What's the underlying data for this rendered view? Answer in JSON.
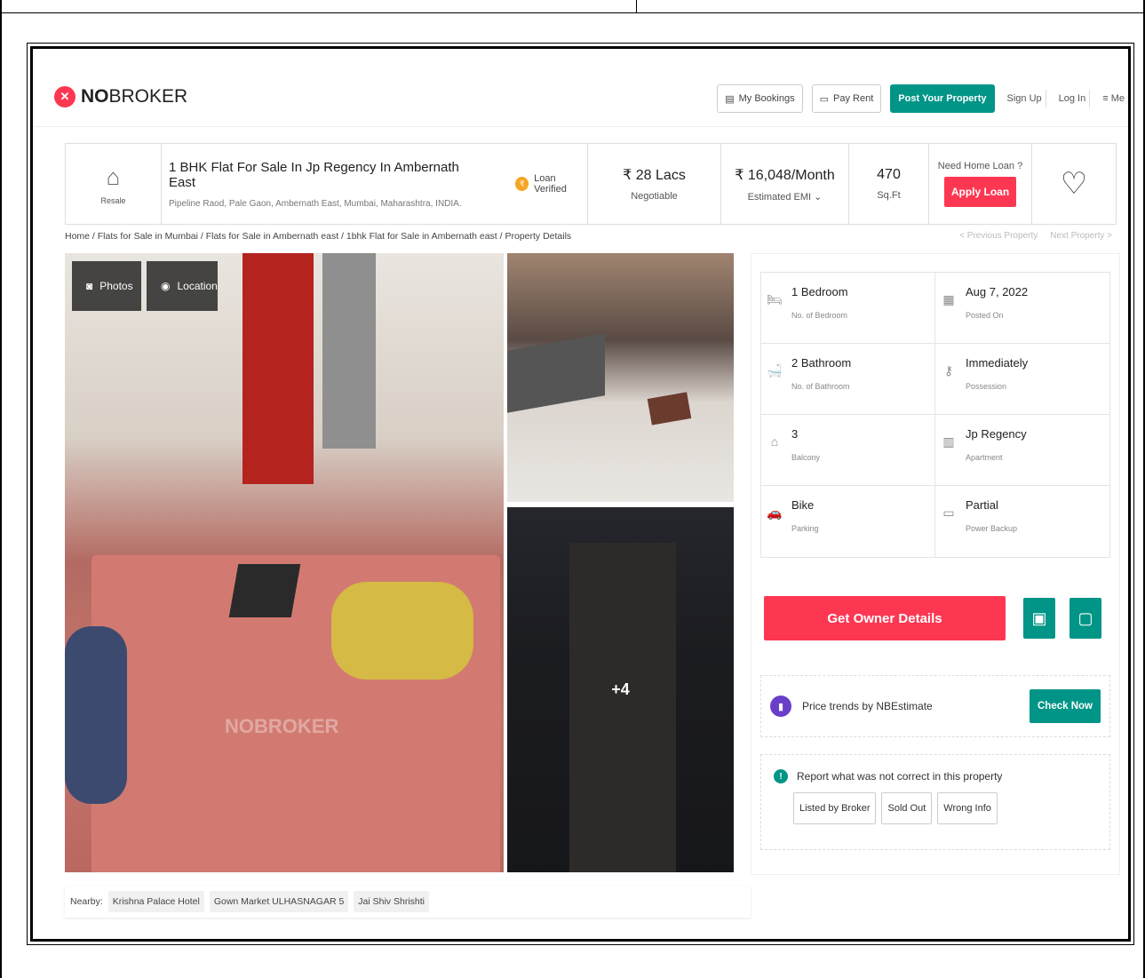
{
  "header": {
    "logo_mark": "✕",
    "logo_bold": "NO",
    "logo_rest": "BROKER",
    "my_bookings": "My Bookings",
    "pay_rent": "Pay Rent",
    "post_property": "Post Your Property",
    "sign_up": "Sign Up",
    "log_in": "Log In",
    "menu": "Me"
  },
  "summary": {
    "type_label": "Resale",
    "title": "1 BHK Flat For Sale In Jp Regency In Ambernath East",
    "address": "Pipeline Raod, Pale Gaon, Ambernath East, Mumbai, Maharashtra, INDIA.",
    "loan_verified": "Loan Verified",
    "price": "₹ 28 Lacs",
    "price_note": "Negotiable",
    "emi": "₹ 16,048/Month",
    "emi_note": "Estimated EMI ⌄",
    "area": "470",
    "area_unit": "Sq.Ft",
    "loan_question": "Need Home Loan ?",
    "apply_loan": "Apply Loan"
  },
  "breadcrumb": "Home / Flats for Sale in Mumbai / Flats for Sale in Ambernath east / 1bhk Flat for Sale in Ambernath east / Property Details",
  "pager": {
    "prev": "< Previous Property",
    "next": "Next Property >"
  },
  "gallery": {
    "photos_label": "Photos",
    "location_label": "Location",
    "more_count": "+4",
    "watermark": "NOBROKER"
  },
  "nearby": {
    "label": "Nearby:",
    "places": [
      "Krishna Palace Hotel",
      "Gown Market ULHASNAGAR 5",
      "Jai Shiv Shrishti"
    ]
  },
  "details": [
    {
      "value": "1 Bedroom",
      "label": "No. of Bedroom",
      "icon": "bed-icon",
      "glyph": "🛏"
    },
    {
      "value": "Aug 7, 2022",
      "label": "Posted On",
      "icon": "calendar-icon",
      "glyph": "▦"
    },
    {
      "value": "2 Bathroom",
      "label": "No. of Bathroom",
      "icon": "bathtub-icon",
      "glyph": "🛁"
    },
    {
      "value": "Immediately",
      "label": "Possession",
      "icon": "key-icon",
      "glyph": "⚷"
    },
    {
      "value": "3",
      "label": "Balcony",
      "icon": "balcony-icon",
      "glyph": "⌂"
    },
    {
      "value": "Jp Regency",
      "label": "Apartment",
      "icon": "building-icon",
      "glyph": "▥"
    },
    {
      "value": "Bike",
      "label": "Parking",
      "icon": "car-icon",
      "glyph": "🚗"
    },
    {
      "value": "Partial",
      "label": "Power Backup",
      "icon": "battery-icon",
      "glyph": "▭"
    }
  ],
  "owner": {
    "label": "Get Owner Details"
  },
  "trend": {
    "label": "Price trends by NBEstimate",
    "button": "Check Now"
  },
  "report": {
    "label": "Report what was not correct in this property",
    "buttons": [
      "Listed by Broker",
      "Sold Out",
      "Wrong Info"
    ]
  },
  "colors": {
    "brand_red": "#fd3752",
    "brand_green": "#009587"
  }
}
